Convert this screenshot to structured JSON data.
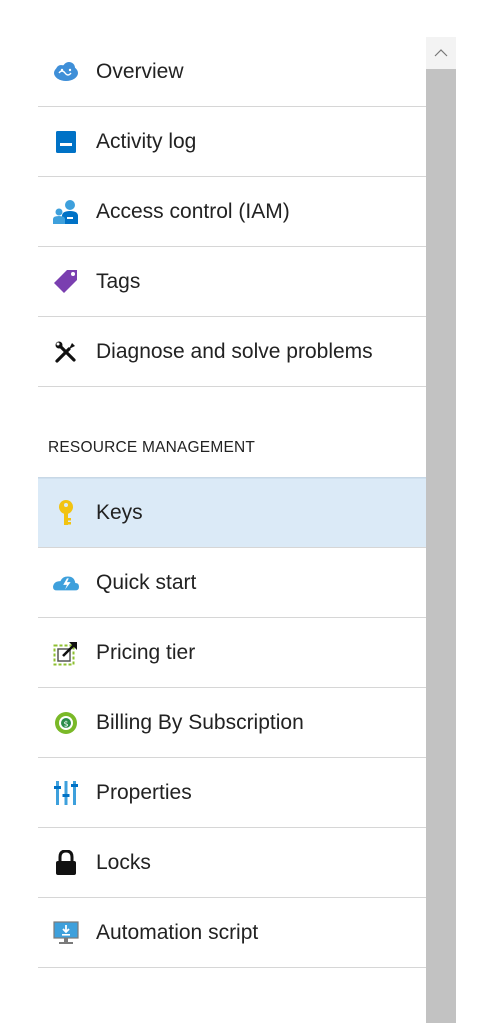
{
  "menu": {
    "items": [
      {
        "label": "Overview",
        "icon": "cloud-brain-icon"
      },
      {
        "label": "Activity log",
        "icon": "activity-log-icon"
      },
      {
        "label": "Access control (IAM)",
        "icon": "people-icon"
      },
      {
        "label": "Tags",
        "icon": "tag-icon"
      },
      {
        "label": "Diagnose and solve problems",
        "icon": "wrench-screwdriver-icon"
      }
    ],
    "section_title": "RESOURCE MANAGEMENT",
    "resource_items": [
      {
        "label": "Keys",
        "icon": "key-icon",
        "selected": true
      },
      {
        "label": "Quick start",
        "icon": "quickstart-cloud-icon"
      },
      {
        "label": "Pricing tier",
        "icon": "pricing-tier-icon"
      },
      {
        "label": "Billing By Subscription",
        "icon": "billing-icon"
      },
      {
        "label": "Properties",
        "icon": "properties-icon"
      },
      {
        "label": "Locks",
        "icon": "lock-icon"
      },
      {
        "label": "Automation script",
        "icon": "automation-script-icon"
      }
    ]
  },
  "colors": {
    "selected_bg": "#dbeaf7",
    "scrollbar_thumb": "#c2c2c2",
    "accent_blue": "#0072c6"
  }
}
